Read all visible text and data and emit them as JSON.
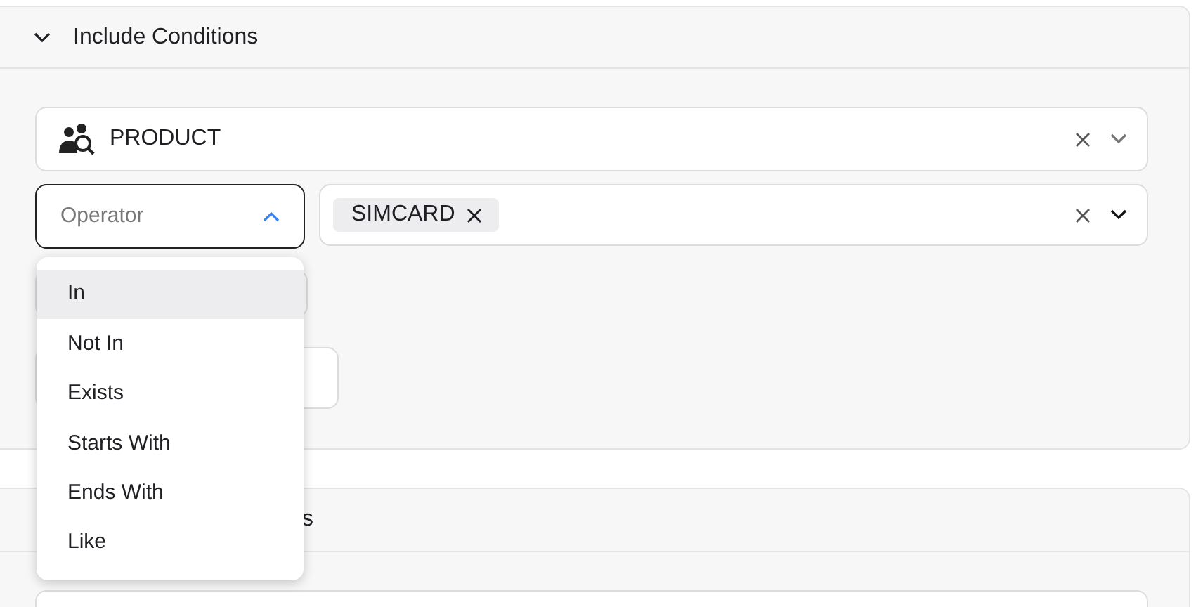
{
  "include_section": {
    "title": "Include Conditions",
    "expanded": true,
    "attribute_field": {
      "value": "PRODUCT"
    },
    "operator_field": {
      "placeholder": "Operator",
      "open": true
    },
    "values_field": {
      "tags": [
        "SIMCARD"
      ]
    }
  },
  "operator_menu": [
    {
      "label": "In",
      "selected": true
    },
    {
      "label": "Not In",
      "selected": false
    },
    {
      "label": "Exists",
      "selected": false
    },
    {
      "label": "Starts With",
      "selected": false
    },
    {
      "label": "Ends With",
      "selected": false
    },
    {
      "label": "Like",
      "selected": false
    }
  ],
  "exclude_section": {
    "title_visible": "s"
  }
}
